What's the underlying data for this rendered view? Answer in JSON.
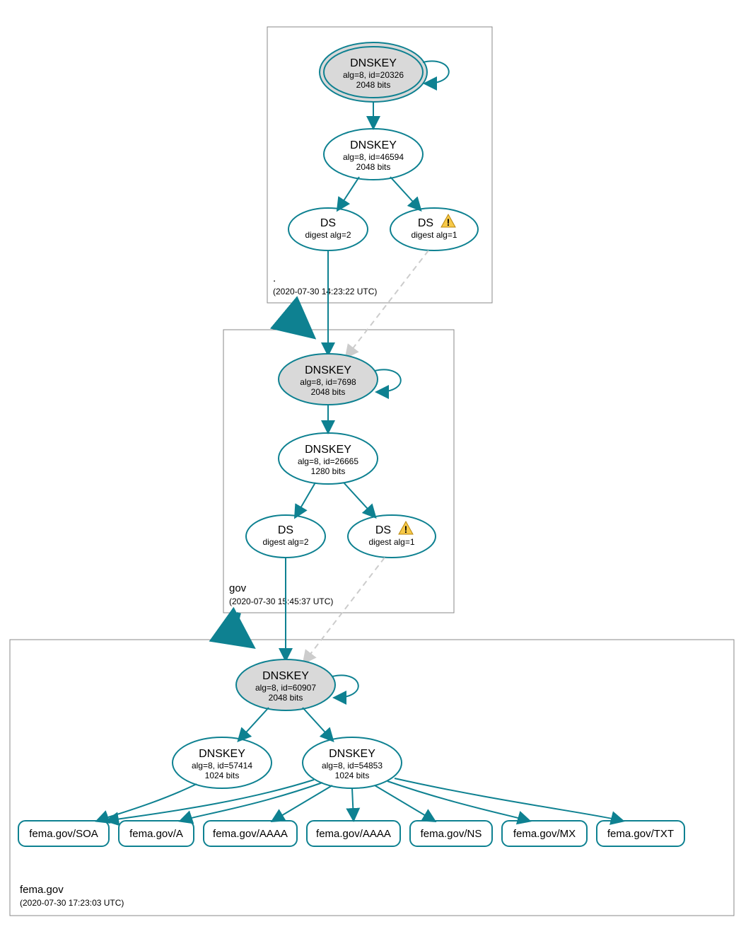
{
  "zones": {
    "root": {
      "label": ".",
      "time": "(2020-07-30 14:23:22 UTC)"
    },
    "gov": {
      "label": "gov",
      "time": "(2020-07-30 15:45:37 UTC)"
    },
    "fema": {
      "label": "fema.gov",
      "time": "(2020-07-30 17:23:03 UTC)"
    }
  },
  "nodes": {
    "root_ksk": {
      "title": "DNSKEY",
      "line2": "alg=8, id=20326",
      "line3": "2048 bits"
    },
    "root_zsk": {
      "title": "DNSKEY",
      "line2": "alg=8, id=46594",
      "line3": "2048 bits"
    },
    "root_ds2": {
      "title": "DS",
      "line2": "digest alg=2"
    },
    "root_ds1": {
      "title": "DS",
      "line2": "digest alg=1"
    },
    "gov_ksk": {
      "title": "DNSKEY",
      "line2": "alg=8, id=7698",
      "line3": "2048 bits"
    },
    "gov_zsk": {
      "title": "DNSKEY",
      "line2": "alg=8, id=26665",
      "line3": "1280 bits"
    },
    "gov_ds2": {
      "title": "DS",
      "line2": "digest alg=2"
    },
    "gov_ds1": {
      "title": "DS",
      "line2": "digest alg=1"
    },
    "fema_ksk": {
      "title": "DNSKEY",
      "line2": "alg=8, id=60907",
      "line3": "2048 bits"
    },
    "fema_zsk1": {
      "title": "DNSKEY",
      "line2": "alg=8, id=57414",
      "line3": "1024 bits"
    },
    "fema_zsk2": {
      "title": "DNSKEY",
      "line2": "alg=8, id=54853",
      "line3": "1024 bits"
    }
  },
  "leaves": {
    "soa": "fema.gov/SOA",
    "a": "fema.gov/A",
    "aaaa1": "fema.gov/AAAA",
    "aaaa2": "fema.gov/AAAA",
    "ns": "fema.gov/NS",
    "mx": "fema.gov/MX",
    "txt": "fema.gov/TXT"
  },
  "colors": {
    "edge": "#0e8191",
    "dash": "#cccccc",
    "ksk_fill": "#d9d9d9"
  }
}
